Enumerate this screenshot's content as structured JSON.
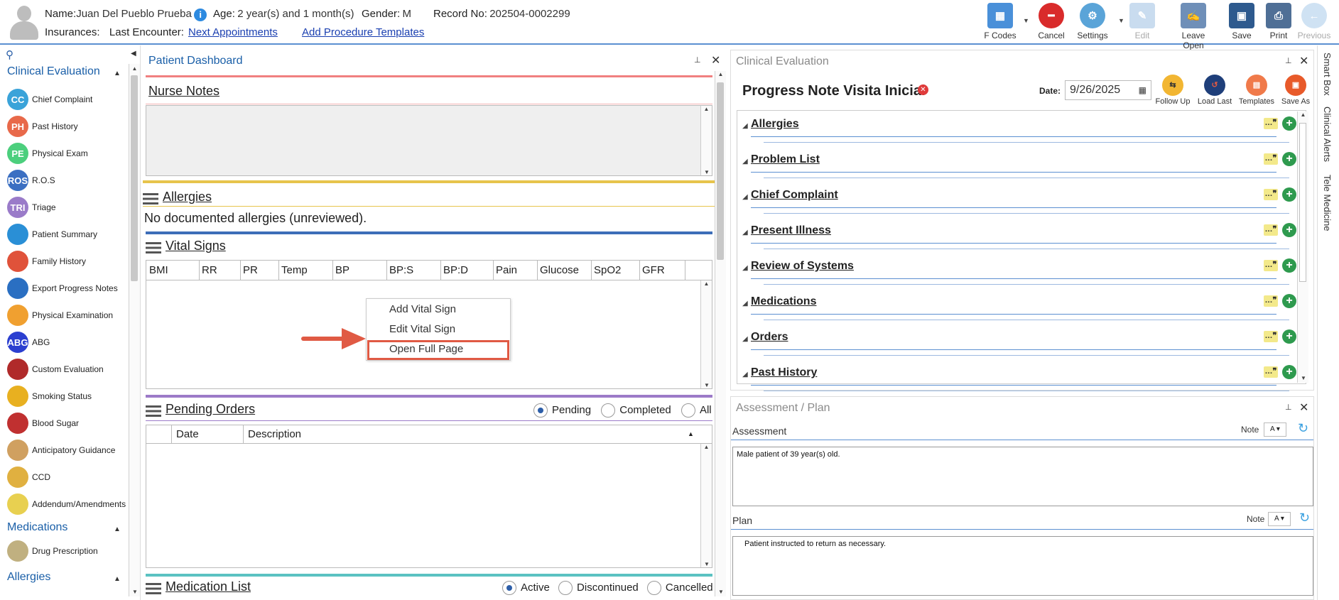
{
  "header": {
    "name_label": "Name:",
    "name_value": "Juan Del Pueblo Prueba",
    "age_label": "Age:",
    "age_value": "2 year(s) and 1 month(s)",
    "gender_label": "Gender:",
    "gender_value": "M",
    "record_label": "Record No:",
    "record_value": "202504-0002299",
    "insurances_label": "Insurances:",
    "last_encounter_label": "Last Encounter:",
    "next_appointments": "Next Appointments",
    "add_procedure_templates": "Add Procedure Templates"
  },
  "toolbar": {
    "fcodes": "F Codes",
    "cancel": "Cancel",
    "settings": "Settings",
    "edit": "Edit",
    "leave_open": "Leave Open",
    "save": "Save",
    "print": "Print",
    "previous": "Previous"
  },
  "sidebar": {
    "cat_clinical": "Clinical Evaluation",
    "items": [
      {
        "label": "Chief Complaint",
        "abbr": "CC",
        "color": "#3aa3d9"
      },
      {
        "label": "Past History",
        "abbr": "PH",
        "color": "#e8694a"
      },
      {
        "label": "Physical Exam",
        "abbr": "PE",
        "color": "#4ccf7d"
      },
      {
        "label": "R.O.S",
        "abbr": "ROS",
        "color": "#3b6fc2"
      },
      {
        "label": "Triage",
        "abbr": "TRI",
        "color": "#9a7bc9"
      },
      {
        "label": "Patient Summary",
        "abbr": "",
        "color": "#2a8fd6"
      },
      {
        "label": "Family History",
        "abbr": "",
        "color": "#e0523a"
      },
      {
        "label": "Export Progress Notes",
        "abbr": "",
        "color": "#2a6fc2"
      },
      {
        "label": "Physical Examination",
        "abbr": "",
        "color": "#f0a030"
      },
      {
        "label": "ABG",
        "abbr": "ABG",
        "color": "#2b3fd0"
      },
      {
        "label": "Custom Evaluation",
        "abbr": "",
        "color": "#b02a2a"
      },
      {
        "label": "Smoking Status",
        "abbr": "",
        "color": "#e8b020"
      },
      {
        "label": "Blood Sugar",
        "abbr": "",
        "color": "#c03030"
      },
      {
        "label": "Anticipatory Guidance",
        "abbr": "",
        "color": "#d0a060"
      },
      {
        "label": "CCD",
        "abbr": "",
        "color": "#e0b040"
      },
      {
        "label": "Addendum/Amendments",
        "abbr": "",
        "color": "#e8d050"
      }
    ],
    "cat_medications": "Medications",
    "med_items": [
      {
        "label": "Drug Prescription",
        "abbr": "",
        "color": "#c0b080"
      }
    ],
    "cat_allergies": "Allergies"
  },
  "dashboard": {
    "title": "Patient Dashboard",
    "nurse_notes": "Nurse Notes",
    "allergies": "Allergies",
    "allergies_text": "No documented allergies (unreviewed).",
    "vital_signs": "Vital Signs",
    "vital_cols": [
      "BMI",
      "RR",
      "PR",
      "Temp",
      "BP",
      "BP:S",
      "BP:D",
      "Pain",
      "Glucose",
      "SpO2",
      "GFR"
    ],
    "context_menu": [
      "Add Vital Sign",
      "Edit Vital Sign",
      "Open Full Page"
    ],
    "pending_orders": "Pending Orders",
    "orders_filters": [
      "Pending",
      "Completed",
      "All"
    ],
    "orders_cols": [
      "Date",
      "Description"
    ],
    "medication_list": "Medication List",
    "med_filters": [
      "Active",
      "Discontinued",
      "Cancelled"
    ]
  },
  "clinical_eval": {
    "title": "Clinical Evaluation",
    "note_title": "Progress Note Visita Inicial",
    "date_label": "Date:",
    "date_value": "9/26/2025",
    "actions": [
      "Follow Up",
      "Load Last",
      "Templates",
      "Save As"
    ],
    "sections": [
      "Allergies",
      "Problem List",
      "Chief Complaint",
      "Present Illness",
      "Review of Systems",
      "Medications",
      "Orders",
      "Past History"
    ]
  },
  "assessment_plan": {
    "title": "Assessment / Plan",
    "assessment_label": "Assessment",
    "note_label": "Note",
    "assessment_text": "Male patient of 39 year(s) old.",
    "plan_label": "Plan",
    "plan_text": "Patient instructed to return as necessary."
  },
  "right_tabs": [
    "Smart Box",
    "Clinical Alerts",
    "Tele Medicine"
  ]
}
